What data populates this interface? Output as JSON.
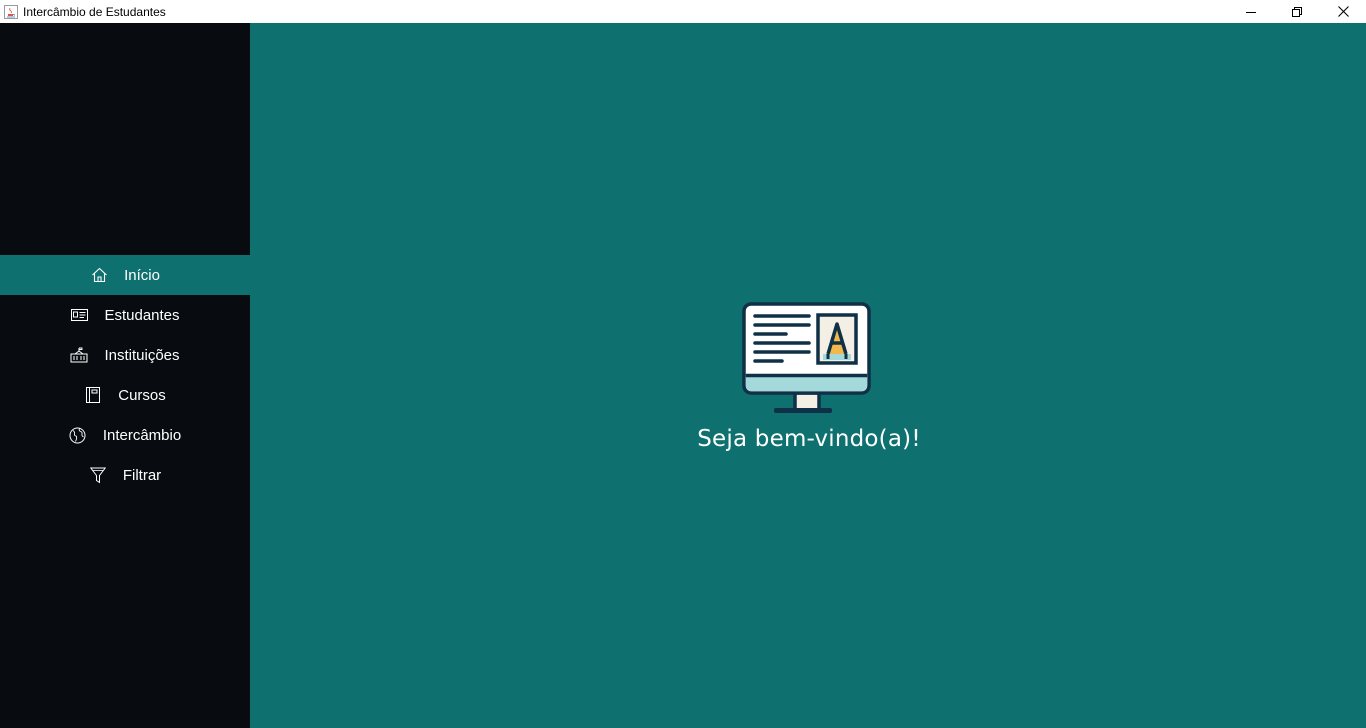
{
  "window": {
    "title": "Intercâmbio de Estudantes",
    "icon": "java-cup-icon"
  },
  "sidebar": {
    "items": [
      {
        "label": "Início",
        "icon": "home-icon",
        "active": true
      },
      {
        "label": "Estudantes",
        "icon": "id-card-icon",
        "active": false
      },
      {
        "label": "Instituições",
        "icon": "building-icon",
        "active": false
      },
      {
        "label": "Cursos",
        "icon": "book-icon",
        "active": false
      },
      {
        "label": "Intercâmbio",
        "icon": "globe-icon",
        "active": false
      },
      {
        "label": "Filtrar",
        "icon": "filter-icon",
        "active": false
      }
    ]
  },
  "main": {
    "welcome": "Seja bem-vindo(a)!",
    "illustration": "computer-monitor-icon"
  },
  "colors": {
    "sidebar_bg": "#080c10",
    "accent": "#0e7170",
    "text": "#ffffff"
  }
}
